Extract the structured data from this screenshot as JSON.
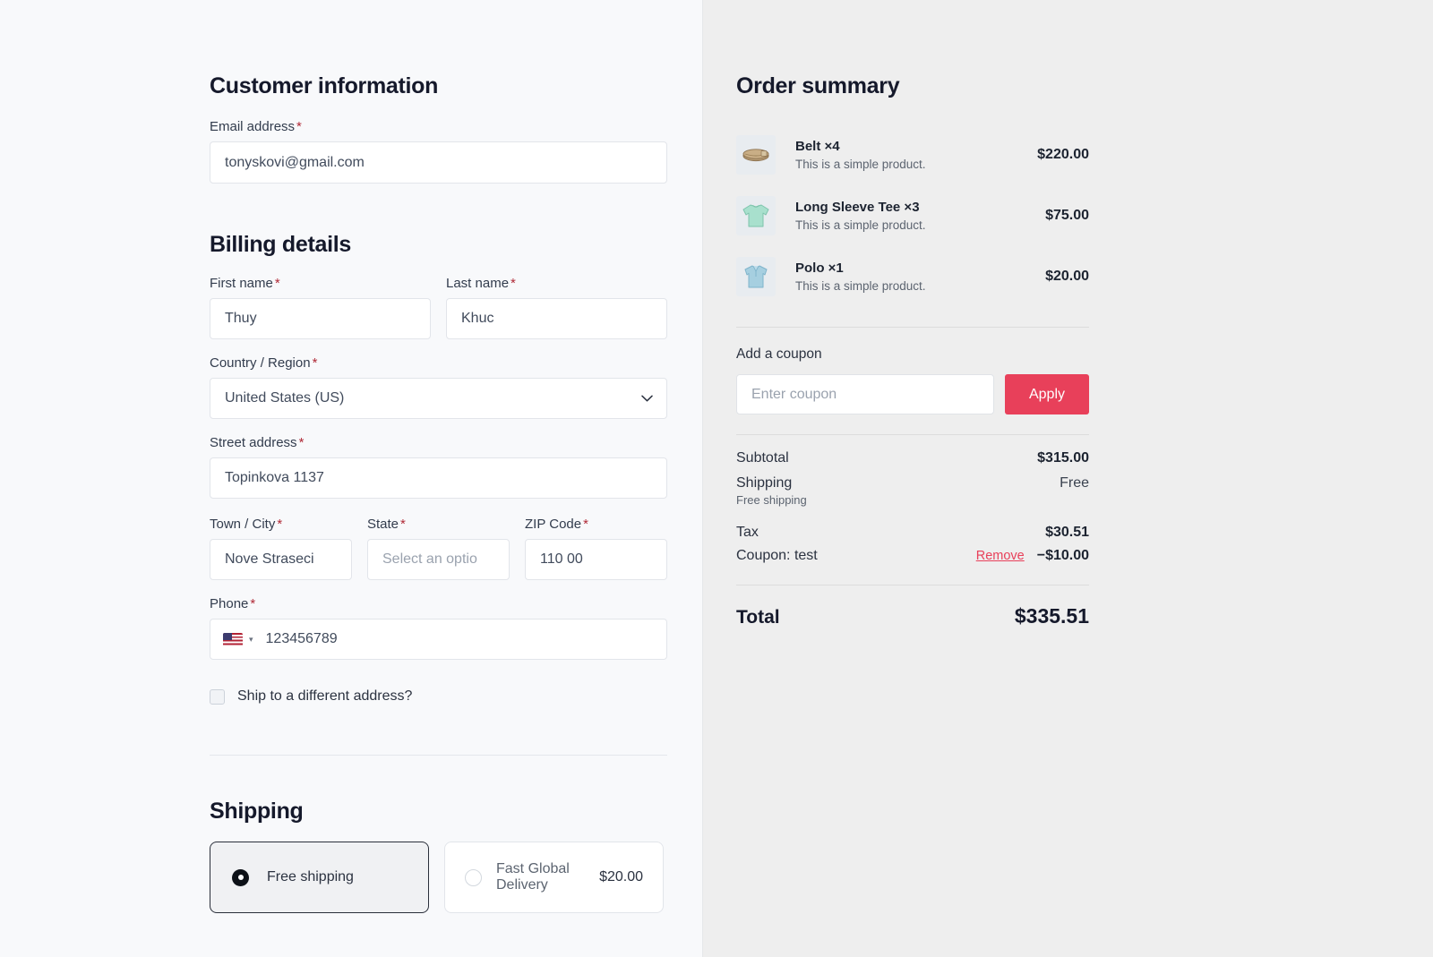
{
  "customer": {
    "title": "Customer information",
    "email_label": "Email address",
    "email_value": "tonyskovi@gmail.com",
    "required_mark": "*"
  },
  "billing": {
    "title": "Billing details",
    "first_name_label": "First name",
    "first_name_value": "Thuy",
    "last_name_label": "Last name",
    "last_name_value": "Khuc",
    "country_label": "Country / Region",
    "country_value": "United States (US)",
    "street_label": "Street address",
    "street_value": "Topinkova 1137",
    "city_label": "Town / City",
    "city_value": "Nove Straseci",
    "state_label": "State",
    "state_value": "Select an optio",
    "zip_label": "ZIP Code",
    "zip_value": "110 00",
    "phone_label": "Phone",
    "phone_value": "123456789",
    "phone_country_flag": "us-flag-icon",
    "ship_different_label": "Ship to a different address?"
  },
  "shipping": {
    "title": "Shipping",
    "options": [
      {
        "label": "Free shipping",
        "price": "",
        "selected": true
      },
      {
        "label": "Fast Global Delivery",
        "price": "$20.00",
        "selected": false
      }
    ]
  },
  "order_summary": {
    "title": "Order summary",
    "items": [
      {
        "name": "Belt ×4",
        "desc": "This is a simple product.",
        "price": "$220.00",
        "thumb": "belt-thumbnail"
      },
      {
        "name": "Long Sleeve Tee ×3",
        "desc": "This is a simple product.",
        "price": "$75.00",
        "thumb": "long-sleeve-tee-thumbnail"
      },
      {
        "name": "Polo ×1",
        "desc": "This is a simple product.",
        "price": "$20.00",
        "thumb": "polo-thumbnail"
      }
    ],
    "coupon_label": "Add a coupon",
    "coupon_placeholder": "Enter coupon",
    "coupon_value": "",
    "apply_label": "Apply",
    "subtotal_label": "Subtotal",
    "subtotal_value": "$315.00",
    "shipping_label": "Shipping",
    "shipping_value": "Free",
    "shipping_note": "Free shipping",
    "tax_label": "Tax",
    "tax_value": "$30.51",
    "coupon_applied_label": "Coupon: test",
    "coupon_remove_label": "Remove",
    "coupon_discount_value": "−$10.00",
    "total_label": "Total",
    "total_value": "$335.51"
  },
  "colors": {
    "accent": "#e8405a",
    "left_bg": "#f8f9fb",
    "right_bg": "#eeeeee",
    "required": "#b02a37",
    "heading": "#15192b"
  }
}
